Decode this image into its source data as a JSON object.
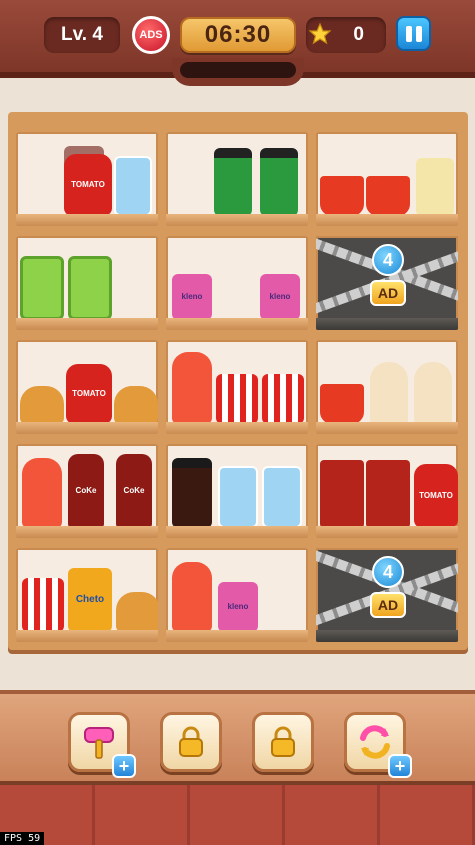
{
  "hud": {
    "level": "Lv. 4",
    "ads_label": "ADS",
    "timer": "06:30",
    "stars": "0"
  },
  "shelf": {
    "locks": [
      {
        "count": "4",
        "ad_label": "AD"
      },
      {
        "count": "4",
        "ad_label": "AD"
      }
    ],
    "labels": {
      "tomato": "TOMATO",
      "kleno": "kleno",
      "coke": "CoKe",
      "cheto": "Cheto"
    }
  },
  "tools": [
    {
      "name": "hammer",
      "has_plus": true
    },
    {
      "name": "locked-slot-1"
    },
    {
      "name": "locked-slot-2"
    },
    {
      "name": "shuffle",
      "has_plus": true
    }
  ],
  "colors": {
    "accent": "#f0a520",
    "shelf_wood": "#d79a5d",
    "pause_blue": "#1b86d6"
  },
  "fps": {
    "label": "FPS",
    "value": "59"
  }
}
